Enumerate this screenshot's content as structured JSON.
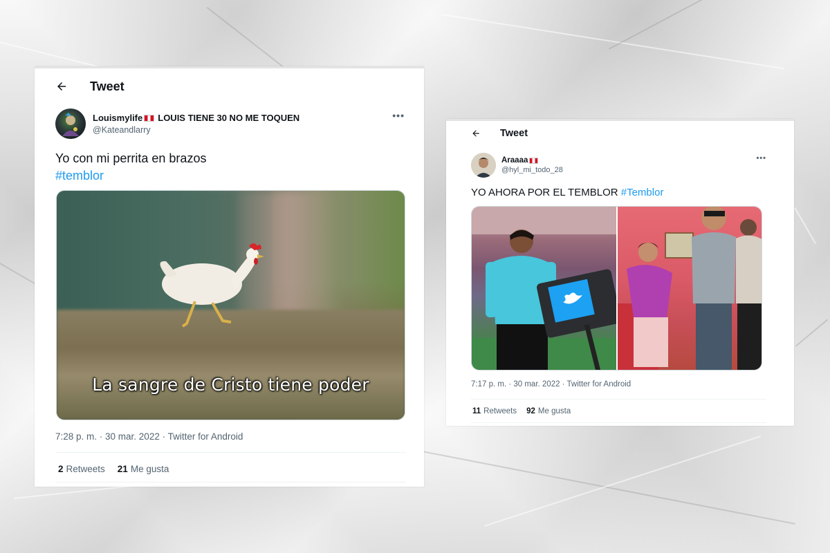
{
  "tweet1": {
    "header_title": "Tweet",
    "display_name": "Louismylife",
    "display_name_suffix": "LOUIS TIENE 30 NO ME TOQUEN",
    "handle": "@Kateandlarry",
    "text": "Yo con mi perrita en brazos",
    "hashtag": "#temblor",
    "image_caption": "La sangre de Cristo tiene poder",
    "timestamp": "7:28 p. m. · 30 mar. 2022 · Twitter for Android",
    "retweets_count": "2",
    "retweets_label": "Retweets",
    "likes_count": "21",
    "likes_label": "Me gusta"
  },
  "tweet2": {
    "header_title": "Tweet",
    "display_name": "Araaaa",
    "handle": "@hyl_mi_todo_28",
    "text": "YO AHORA POR EL TEMBLOR",
    "hashtag": "#Temblor",
    "timestamp": "7:17 p. m. · 30 mar. 2022 · Twitter for Android",
    "retweets_count": "11",
    "retweets_label": "Retweets",
    "likes_count": "92",
    "likes_label": "Me gusta"
  },
  "icons": {
    "back": "arrow-left-icon",
    "more": "more-horizontal-icon",
    "flag": "peru-flag-icon",
    "twitter": "twitter-bird-icon"
  },
  "colors": {
    "link": "#1d9bf0",
    "text_primary": "#0f1419",
    "text_secondary": "#536471",
    "divider": "#eff3f4"
  }
}
